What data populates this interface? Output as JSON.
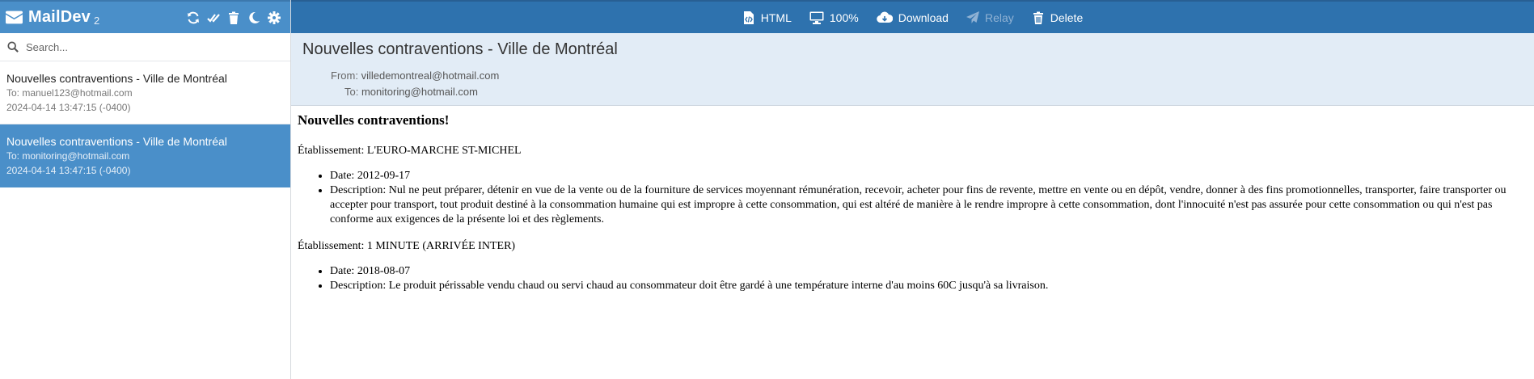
{
  "sidebar": {
    "brand": "MailDev",
    "count": "2",
    "search_placeholder": "Search...",
    "emails": [
      {
        "subject": "Nouvelles contraventions - Ville de Montréal",
        "to": "To: manuel123@hotmail.com",
        "date": "2024-04-14 13:47:15 (-0400)",
        "selected": false
      },
      {
        "subject": "Nouvelles contraventions - Ville de Montréal",
        "to": "To: monitoring@hotmail.com",
        "date": "2024-04-14 13:47:15 (-0400)",
        "selected": true
      }
    ]
  },
  "toolbar": {
    "html_label": "HTML",
    "zoom_label": "100%",
    "download_label": "Download",
    "relay_label": "Relay",
    "delete_label": "Delete"
  },
  "message": {
    "subject": "Nouvelles contraventions - Ville de Montréal",
    "from_label": "From:",
    "from": "villedemontreal@hotmail.com",
    "to_label": "To:",
    "to": "monitoring@hotmail.com",
    "body": {
      "heading": "Nouvelles contraventions!",
      "establishments": [
        {
          "label": "Établissement: L'EURO-MARCHE ST-MICHEL",
          "date": "Date: 2012-09-17",
          "description": "Description: Nul ne peut préparer, détenir en vue de la vente ou de la fourniture de services moyennant rémunération, recevoir, acheter pour fins de revente, mettre en vente ou en dépôt, vendre, donner à des fins promotionnelles, transporter, faire transporter ou accepter pour transport, tout produit destiné à la consommation humaine qui est impropre à cette consommation, qui est altéré de manière à le rendre impropre à cette consommation, dont l'innocuité n'est pas assurée pour cette consommation ou qui n'est pas conforme aux exigences de la présente loi et des règlements."
        },
        {
          "label": "Établissement: 1 MINUTE (ARRIVÉE INTER)",
          "date": "Date: 2018-08-07",
          "description": "Description: Le produit périssable vendu chaud ou servi chaud au consommateur doit être gardé à une température interne d'au moins 60C jusqu'à sa livraison."
        }
      ]
    }
  },
  "icons": {
    "logo": "envelope-icon",
    "refresh": "refresh-icon",
    "mark_read": "double-check-icon",
    "trash": "trash-icon",
    "dark_mode": "moon-icon",
    "settings": "gear-icon",
    "search": "search-icon",
    "html": "file-code-icon",
    "zoom": "monitor-icon",
    "download": "cloud-download-icon",
    "relay": "paper-plane-icon",
    "delete": "trash-icon"
  },
  "colors": {
    "sidebar_header": "#4a8fc9",
    "topbar": "#2e72ae",
    "selected_item": "#4a8fc9",
    "message_header": "#e2ecf6"
  }
}
